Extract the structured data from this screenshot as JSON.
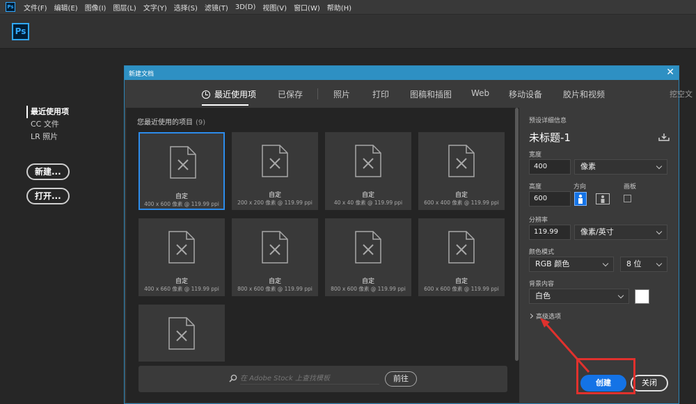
{
  "menubar": {
    "app": "Ps",
    "items": [
      "文件(F)",
      "编辑(E)",
      "图像(I)",
      "图层(L)",
      "文字(Y)",
      "选择(S)",
      "滤镜(T)",
      "3D(D)",
      "视图(V)",
      "窗口(W)",
      "帮助(H)"
    ]
  },
  "app_logo": "Ps",
  "start": {
    "nav": [
      "最近使用项",
      "CC 文件",
      "LR 照片"
    ],
    "new_button": "新建...",
    "open_button": "打开..."
  },
  "dialog": {
    "title": "新建文档",
    "tabs": [
      "最近使用项",
      "已保存",
      "照片",
      "打印",
      "图稿和插图",
      "Web",
      "移动设备",
      "胶片和视频"
    ],
    "tab_overflow": "挖空文",
    "recent_heading": "您最近使用的项目",
    "recent_count": "(9)",
    "presets": [
      {
        "name": "自定",
        "spec": "400 x 600 像素 @ 119.99 ppi",
        "selected": true
      },
      {
        "name": "自定",
        "spec": "200 x 200 像素 @ 119.99 ppi"
      },
      {
        "name": "自定",
        "spec": "40 x 40 像素 @ 119.99 ppi"
      },
      {
        "name": "自定",
        "spec": "600 x 400 像素 @ 119.99 ppi"
      },
      {
        "name": "自定",
        "spec": "400 x 660 像素 @ 119.99 ppi"
      },
      {
        "name": "自定",
        "spec": "800 x 600 像素 @ 119.99 ppi"
      },
      {
        "name": "自定",
        "spec": "800 x 600 像素 @ 119.99 ppi"
      },
      {
        "name": "自定",
        "spec": "600 x 600 像素 @ 119.99 ppi"
      },
      {
        "name": "",
        "spec": ""
      }
    ],
    "search_placeholder": "在 Adobe Stock 上查找模板",
    "search_go": "前往"
  },
  "details": {
    "heading": "预设详细信息",
    "doc_name": "未标题-1",
    "width_label": "宽度",
    "width_value": "400",
    "width_unit": "像素",
    "height_label": "高度",
    "height_value": "600",
    "orientation_label": "方向",
    "artboard_label": "画板",
    "resolution_label": "分辨率",
    "resolution_value": "119.99",
    "resolution_unit": "像素/英寸",
    "color_mode_label": "颜色模式",
    "color_mode": "RGB 颜色",
    "bit_depth": "8 位",
    "background_label": "背景内容",
    "background": "白色",
    "background_color": "#ffffff",
    "advanced": "高级选项",
    "create_button": "创建",
    "close_button": "关闭"
  },
  "colors": {
    "accent": "#1473e6",
    "titlebar": "#2e90c3",
    "highlight": "#e0312d"
  }
}
